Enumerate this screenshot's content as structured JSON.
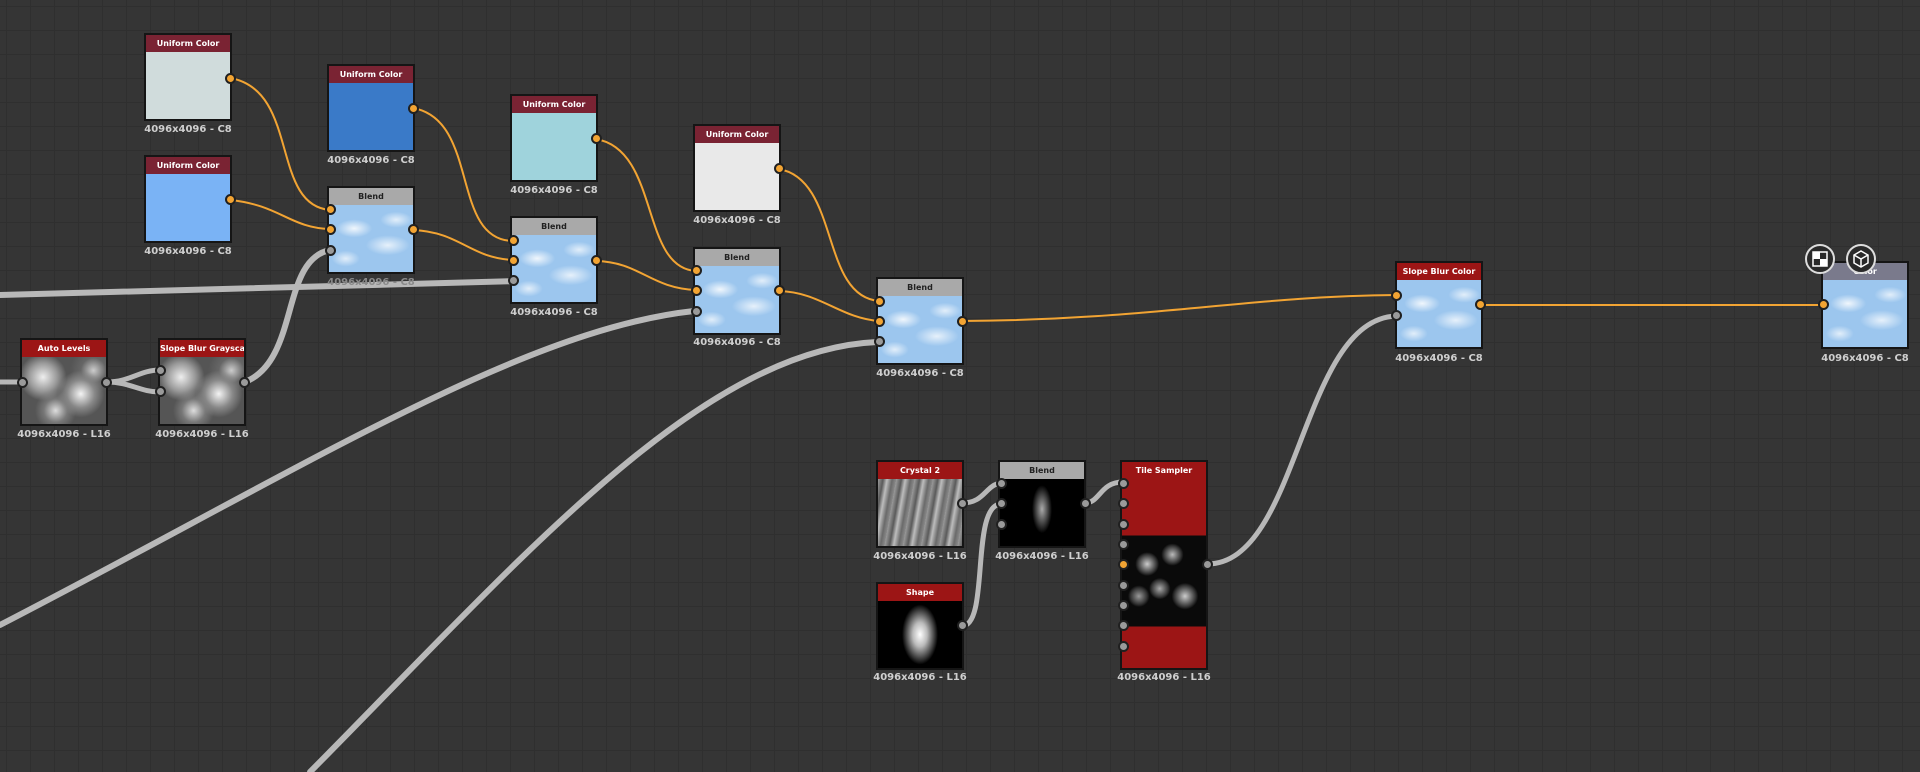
{
  "nodes": {
    "uni1": {
      "title": "Uniform Color",
      "res": "4096x4096 - C8",
      "color": "#d0dcdc"
    },
    "uni2": {
      "title": "Uniform Color",
      "res": "4096x4096 - C8",
      "color": "#7ab3f5"
    },
    "uni3": {
      "title": "Uniform Color",
      "res": "4096x4096 - C8",
      "color": "#3a7ac8"
    },
    "uni4": {
      "title": "Uniform Color",
      "res": "4096x4096 - C8",
      "color": "#9fd3dc"
    },
    "uni5": {
      "title": "Uniform Color",
      "res": "4096x4096 - C8",
      "color": "#e9e9e9"
    },
    "blend1": {
      "title": "Blend",
      "res": "4096x4096 - C8"
    },
    "blend2": {
      "title": "Blend",
      "res": "4096x4096 - C8"
    },
    "blend3": {
      "title": "Blend",
      "res": "4096x4096 - C8"
    },
    "blend4": {
      "title": "Blend",
      "res": "4096x4096 - C8"
    },
    "autolevels": {
      "title": "Auto Levels",
      "res": "4096x4096 - L16"
    },
    "slopegray": {
      "title": "Slope Blur Grayscale",
      "res": "4096x4096 - L16"
    },
    "slopecolor": {
      "title": "Slope Blur Color",
      "res": "4096x4096 - C8"
    },
    "output": {
      "title": "Color",
      "res": "4096x4096 - C8"
    },
    "crystal": {
      "title": "Crystal 2",
      "res": "4096x4096 - L16"
    },
    "shape": {
      "title": "Shape",
      "res": "4096x4096 - L16"
    },
    "blend5": {
      "title": "Blend",
      "res": "4096x4096 - L16"
    },
    "tilesampler": {
      "title": "Tile Sampler",
      "res": "4096x4096 - L16"
    }
  },
  "toolbar": {
    "icons": [
      "checker-view-icon",
      "3d-cube-icon"
    ]
  },
  "colors": {
    "wire_color": "#f2a433",
    "wire_gray": "#b8b8b8",
    "uniform_header": "#7a2333",
    "filter_header": "#9c1515"
  }
}
